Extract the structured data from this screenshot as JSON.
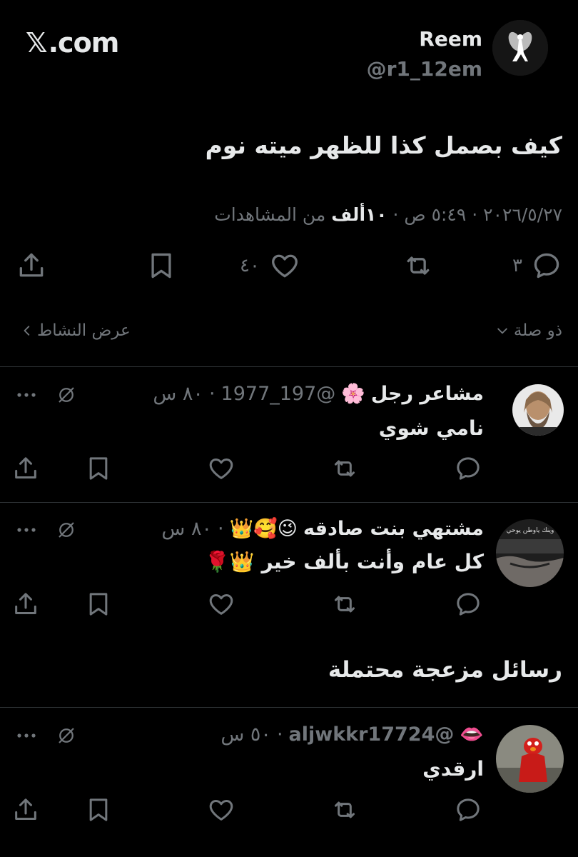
{
  "header": {
    "site_label": ".com",
    "site_x": "𝕏"
  },
  "author": {
    "name": "Reem",
    "handle": "@r1_12em",
    "avatar_icon": "angel-silhouette-icon"
  },
  "tweet": {
    "text": "كيف بصمل كذا للظهر ميته نوم",
    "date": "٢٠٢٦/٥/٢٧",
    "sep": "·",
    "time": "٥:٤٩ ص",
    "views_count": "١٠ألف",
    "views_label": "من المشاهدات"
  },
  "actions": {
    "replies": "٣",
    "likes": "٤٠"
  },
  "context": {
    "relevance_label": "ذو صلة",
    "activity_label": "عرض النشاط"
  },
  "replies": [
    {
      "name": "مشاعر رجل",
      "emoji": "🌸",
      "handle": "@197_1977",
      "time": "٨٠ س",
      "text": "نامي شوي"
    },
    {
      "name": "مشتهي بنت صادقه",
      "emoji": "😉🥰👑",
      "handle": "",
      "time": "٨٠ س",
      "text": "كل عام وأنت بألف خير",
      "text_emoji": "👑🌹",
      "avatar_caption": "وينك ياوطن يوحي"
    }
  ],
  "spam_section": {
    "title": "رسائل مزعجة محتملة"
  },
  "spam_replies": [
    {
      "name": "",
      "emoji": "👄",
      "handle": "@aljwkkr17724",
      "time": "٥٠ س",
      "text": "ارقدي"
    }
  ]
}
